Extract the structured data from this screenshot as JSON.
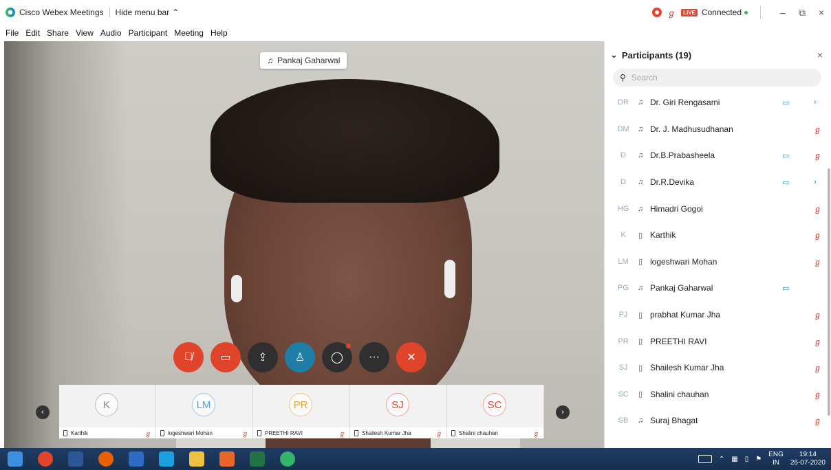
{
  "title_bar": {
    "app_name": "Cisco Webex Meetings",
    "hide_menu": "Hide menu bar",
    "hide_menu_icon": "chevron-up",
    "live_badge": "LIVE",
    "status": "Connected",
    "minimize": "–",
    "restore": "⧉",
    "close": "×"
  },
  "menu": [
    "File",
    "Edit",
    "Share",
    "View",
    "Audio",
    "Participant",
    "Meeting",
    "Help"
  ],
  "video": {
    "active_speaker": "Pankaj Gaharwal"
  },
  "controls": [
    {
      "name": "mute",
      "icon": "mic-off-icon",
      "glyph": "🎙̸"
    },
    {
      "name": "stop-video",
      "icon": "video-off-icon",
      "glyph": "▭̸"
    },
    {
      "name": "share",
      "icon": "share-icon",
      "glyph": "⇪"
    },
    {
      "name": "participants",
      "icon": "participants-icon",
      "glyph": "👤"
    },
    {
      "name": "chat",
      "icon": "chat-icon",
      "glyph": "◯"
    },
    {
      "name": "more",
      "icon": "more-icon",
      "glyph": "···"
    },
    {
      "name": "leave",
      "icon": "close-icon",
      "glyph": "✕"
    }
  ],
  "filmstrip": [
    {
      "initials": "K",
      "name": "Karthik",
      "color": "#888888"
    },
    {
      "initials": "LM",
      "name": "logeshwari Mohan",
      "color": "#4aa3df"
    },
    {
      "initials": "PR",
      "name": "PREETHI RAVI",
      "color": "#e6a02a"
    },
    {
      "initials": "SJ",
      "name": "Shailesh Kumar Jha",
      "color": "#e0452c"
    },
    {
      "initials": "SC",
      "name": "Shalini chauhan",
      "color": "#e0452c"
    }
  ],
  "panel": {
    "title": "Participants (19)",
    "search_placeholder": "Search",
    "participants": [
      {
        "initials": "DR",
        "name": "Dr. Giri Rengasami",
        "device": "headset",
        "video": true,
        "muted": false,
        "chevron": true
      },
      {
        "initials": "DM",
        "name": "Dr. J. Madhusudhanan",
        "device": "headset",
        "video": false,
        "muted": true,
        "chevron": false
      },
      {
        "initials": "D",
        "name": "Dr.B.Prabasheela",
        "device": "headset",
        "video": true,
        "muted": true,
        "chevron": false
      },
      {
        "initials": "D",
        "name": "Dr.R.Devika",
        "device": "headset",
        "video": true,
        "muted": false,
        "chevron": true
      },
      {
        "initials": "HG",
        "name": "Himadri Gogoi",
        "device": "headset",
        "video": false,
        "muted": true,
        "chevron": false
      },
      {
        "initials": "K",
        "name": "Karthik",
        "device": "phone",
        "video": false,
        "muted": true,
        "chevron": false
      },
      {
        "initials": "LM",
        "name": "logeshwari Mohan",
        "device": "phone",
        "video": false,
        "muted": true,
        "chevron": false
      },
      {
        "initials": "PG",
        "name": "Pankaj Gaharwal",
        "device": "headset",
        "video": true,
        "muted": false,
        "chevron": false
      },
      {
        "initials": "PJ",
        "name": "prabhat Kumar Jha",
        "device": "phone",
        "video": false,
        "muted": true,
        "chevron": false
      },
      {
        "initials": "PR",
        "name": "PREETHI RAVI",
        "device": "phone",
        "video": false,
        "muted": true,
        "chevron": false
      },
      {
        "initials": "SJ",
        "name": "Shailesh Kumar Jha",
        "device": "phone",
        "video": false,
        "muted": true,
        "chevron": false
      },
      {
        "initials": "SC",
        "name": "Shalini chauhan",
        "device": "phone",
        "video": false,
        "muted": true,
        "chevron": false
      },
      {
        "initials": "SB",
        "name": "Suraj Bhagat",
        "device": "headset",
        "video": false,
        "muted": true,
        "chevron": false
      }
    ]
  },
  "taskbar": {
    "apps": [
      {
        "name": "start",
        "color": "#3d8fe0"
      },
      {
        "name": "chrome",
        "color": "#e0452c"
      },
      {
        "name": "word",
        "color": "#2b5797"
      },
      {
        "name": "firefox",
        "color": "#e66000"
      },
      {
        "name": "security",
        "color": "#2c6cc4"
      },
      {
        "name": "internet-explorer",
        "color": "#1ba1e2"
      },
      {
        "name": "file-explorer",
        "color": "#f0c040"
      },
      {
        "name": "media-player",
        "color": "#e8662a"
      },
      {
        "name": "excel",
        "color": "#217346"
      },
      {
        "name": "webex",
        "color": "#35b56a"
      }
    ],
    "lang_top": "ENG",
    "lang_bottom": "IN",
    "time": "19:14",
    "date": "26-07-2020"
  }
}
